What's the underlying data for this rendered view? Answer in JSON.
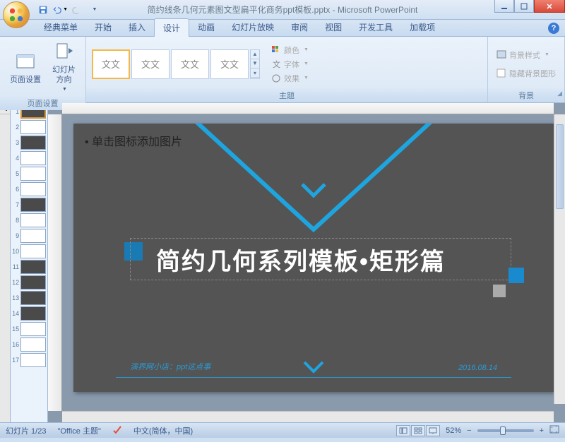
{
  "titlebar": {
    "filename": "简约线条几何元素图文型扁平化商务ppt模板.pptx",
    "app": "Microsoft PowerPoint"
  },
  "tabs": {
    "items": [
      "经典菜单",
      "开始",
      "插入",
      "设计",
      "动画",
      "幻灯片放映",
      "审阅",
      "视图",
      "开发工具",
      "加载项"
    ],
    "active_index": 3
  },
  "ribbon": {
    "page_setup": {
      "label": "页面设置",
      "btn1": "页面设置",
      "btn2": "幻灯片\n方向"
    },
    "themes": {
      "label": "主题",
      "sample": "文文",
      "colors": "颜色",
      "fonts": "字体",
      "effects": "效果"
    },
    "background": {
      "label": "背景",
      "style": "背景样式",
      "hide": "隐藏背景图形"
    }
  },
  "slide": {
    "placeholder": "• 单击图标添加图片",
    "title": "简约几何系列模板•矩形篇",
    "footer_left": "演界网小店：ppt这点事",
    "footer_right": "2016.08.14"
  },
  "thumbs": {
    "count": 17,
    "selected": 1
  },
  "status": {
    "slide_counter": "幻灯片 1/23",
    "theme": "\"Office 主题\"",
    "lang": "中文(简体，中国)",
    "zoom": "52%"
  }
}
